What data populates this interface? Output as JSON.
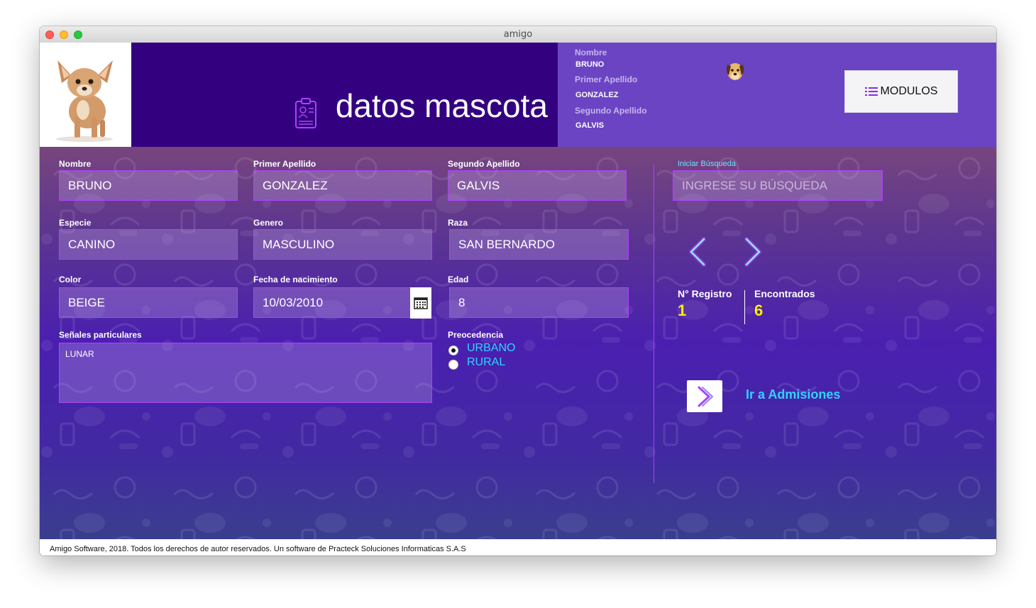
{
  "window": {
    "title": "amigo"
  },
  "header": {
    "title": "datos mascota",
    "info": {
      "nombre_label": "Nombre",
      "nombre": "BRUNO",
      "primer_apellido_label": "Primer Apellido",
      "primer_apellido": "GONZALEZ",
      "segundo_apellido_label": "Segundo Apellido",
      "segundo_apellido": "GALVIS"
    },
    "modulos_label": "MODULOS"
  },
  "form": {
    "nombre": {
      "label": "Nombre",
      "value": "BRUNO"
    },
    "primer_apellido": {
      "label": "Primer Apellido",
      "value": "GONZALEZ"
    },
    "segundo_apellido": {
      "label": "Segundo Apellido",
      "value": "GALVIS"
    },
    "especie": {
      "label": "Especie",
      "value": "CANINO"
    },
    "genero": {
      "label": "Genero",
      "value": "MASCULINO"
    },
    "raza": {
      "label": "Raza",
      "value": "SAN BERNARDO"
    },
    "color": {
      "label": "Color",
      "value": "BEIGE"
    },
    "fecha_nacimiento": {
      "label": "Fecha de nacimiento",
      "value": "10/03/2010"
    },
    "edad": {
      "label": "Edad",
      "value": "8"
    },
    "senales": {
      "label": "Señales particulares",
      "value": "LUNAR"
    },
    "procedencia": {
      "label": "Preocedencia",
      "options": [
        "URBANO",
        "RURAL"
      ],
      "selected": "URBANO"
    }
  },
  "search": {
    "label": "Iniciar Búsqueda",
    "placeholder": "INGRESE SU BÚSQUEDA"
  },
  "stats": {
    "registro_label": "N° Registro",
    "registro_value": "1",
    "encontrados_label": "Encontrados",
    "encontrados_value": "6"
  },
  "admisiones_label": "Ir a Admisiones",
  "footer": "Amigo Software, 2018. Todos los derechos de autor reservados. Un software de Practeck Soluciones Informaticas S.A.S",
  "colors": {
    "header_dark": "#330080",
    "header_light": "#6b44c3",
    "field_border": "#b040ff",
    "accent_cyan": "#2fd3ff",
    "accent_yellow": "#ffee00"
  }
}
